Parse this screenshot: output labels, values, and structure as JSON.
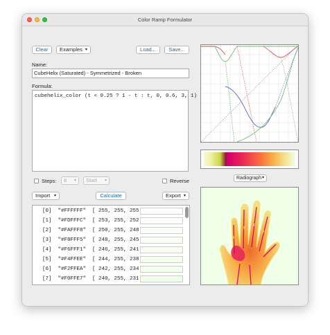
{
  "window": {
    "title": "Color Ramp Formulator"
  },
  "toolbar": {
    "clear": "Clear",
    "examples": "Examples",
    "load": "Load...",
    "save": "Save..."
  },
  "name": {
    "label": "Name:",
    "value": "CubeHelix (Saturated) - Symmetrized - Broken"
  },
  "formula": {
    "label": "Formula:",
    "value": "cubehelix_color (t < 0.25 ? 1 - t : t, 0, 0.6, 3, 1)"
  },
  "steps": {
    "label": "Steps:",
    "value": "8",
    "start": "Start",
    "reverse": "Reverse"
  },
  "actions": {
    "import": "Import",
    "calculate": "Calculate",
    "export": "Export"
  },
  "rows": [
    {
      "text": "[0]  \"#FFFFFF\"  [ 255, 255, 255 ]",
      "color": "#FFFFFF"
    },
    {
      "text": "[1]  \"#FDFFFC\"  [ 253, 255, 252 ]",
      "color": "#FDFFFC"
    },
    {
      "text": "[2]  \"#FAFFF8\"  [ 250, 255, 248 ]",
      "color": "#FAFFF8"
    },
    {
      "text": "[3]  \"#F8FFF5\"  [ 248, 255, 245 ]",
      "color": "#F8FFF5"
    },
    {
      "text": "[4]  \"#F6FFF1\"  [ 246, 255, 241 ]",
      "color": "#F6FFF1"
    },
    {
      "text": "[5]  \"#F4FFEE\"  [ 244, 255, 238 ]",
      "color": "#F4FFEE"
    },
    {
      "text": "[6]  \"#F2FFEA\"  [ 242, 255, 234 ]",
      "color": "#F2FFEA"
    },
    {
      "text": "[7]  \"#F0FFE7\"  [ 240, 255, 231 ]",
      "color": "#F0FFE7"
    }
  ],
  "preview": {
    "image_select": "Radiograph"
  }
}
